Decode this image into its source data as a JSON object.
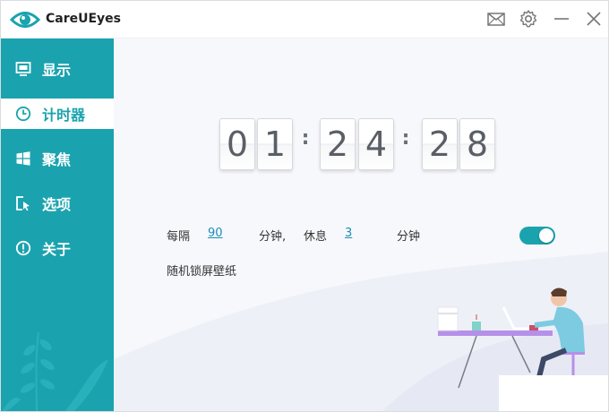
{
  "app": {
    "title": "CareUEyes"
  },
  "titlebar": {
    "buttons": [
      "mail-icon",
      "gear-icon",
      "minimize-icon",
      "close-icon"
    ]
  },
  "sidebar": {
    "items": [
      {
        "label": "显示",
        "icon": "monitor-icon",
        "active": false
      },
      {
        "label": "计时器",
        "icon": "clock-icon",
        "active": true
      },
      {
        "label": "聚焦",
        "icon": "windows-icon",
        "active": false
      },
      {
        "label": "选项",
        "icon": "cursor-icon",
        "active": false
      },
      {
        "label": "关于",
        "icon": "info-icon",
        "active": false
      }
    ]
  },
  "timer": {
    "digits": [
      "0",
      "1",
      "2",
      "4",
      "2",
      "8"
    ],
    "separator": ":"
  },
  "settings": {
    "every_label": "每隔",
    "work_minutes": "90",
    "minutes_label_1": "分钟,",
    "rest_label": "休息",
    "rest_minutes": "3",
    "minutes_label_2": "分钟",
    "timer_enabled": true,
    "lock_wallpaper_label": "随机锁屏壁纸",
    "lock_wallpaper_enabled": false
  },
  "colors": {
    "accent": "#1aa3ae",
    "link": "#1b8fb5",
    "toggle_off": "#d9dadc"
  }
}
